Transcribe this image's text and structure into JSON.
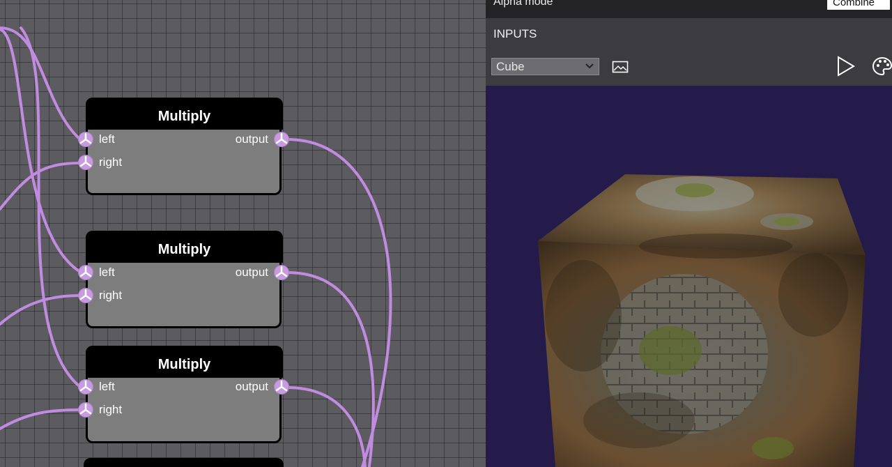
{
  "graph": {
    "nodes": [
      {
        "title": "Multiply",
        "inputs": [
          "left",
          "right"
        ],
        "output": "output"
      },
      {
        "title": "Multiply",
        "inputs": [
          "left",
          "right"
        ],
        "output": "output"
      },
      {
        "title": "Multiply",
        "inputs": [
          "left",
          "right"
        ],
        "output": "output"
      }
    ],
    "wire_color": "#c18ce0",
    "node_header_color": "#000000",
    "node_body_color": "#7d7d7d"
  },
  "panel": {
    "alpha_mode_label": "Alpha mode",
    "alpha_mode_value": "Combine",
    "inputs_title": "INPUTS",
    "mesh_select_value": "Cube",
    "icons": [
      "image-icon",
      "play-icon",
      "palette-icon"
    ],
    "viewport_background": "#251b4b"
  }
}
